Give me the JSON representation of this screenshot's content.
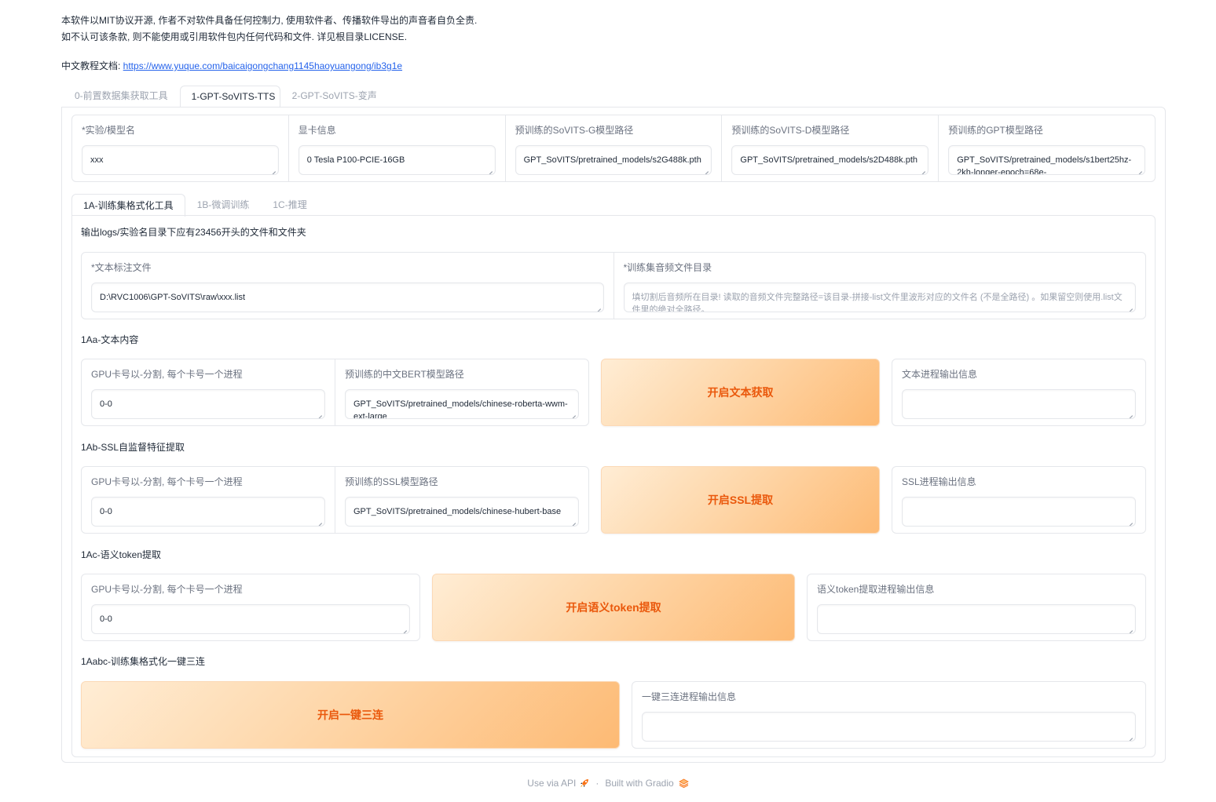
{
  "notice": {
    "line1": "本软件以MIT协议开源, 作者不对软件具备任何控制力, 使用软件者、传播软件导出的声音者自负全责.",
    "line2": "如不认可该条款, 则不能使用或引用软件包内任何代码和文件. 详见根目录LICENSE."
  },
  "doc": {
    "label": "中文教程文档: ",
    "link": "https://www.yuque.com/baicaigongchang1145haoyuangong/ib3g1e"
  },
  "top_tabs": [
    "0-前置数据集获取工具",
    "1-GPT-SoVITS-TTS",
    "2-GPT-SoVITS-变声"
  ],
  "model_row": [
    {
      "label": "*实验/模型名",
      "value": "xxx"
    },
    {
      "label": "显卡信息",
      "value": "0 Tesla P100-PCIE-16GB"
    },
    {
      "label": "预训练的SoVITS-G模型路径",
      "value": "GPT_SoVITS/pretrained_models/s2G488k.pth"
    },
    {
      "label": "预训练的SoVITS-D模型路径",
      "value": "GPT_SoVITS/pretrained_models/s2D488k.pth"
    },
    {
      "label": "预训练的GPT模型路径",
      "value": "GPT_SoVITS/pretrained_models/s1bert25hz-2kh-longer-epoch=68e-"
    }
  ],
  "sub_tabs": [
    "1A-训练集格式化工具",
    "1B-微调训练",
    "1C-推理"
  ],
  "info_text": "输出logs/实验名目录下应有23456开头的文件和文件夹",
  "text_label_file": {
    "label": "*文本标注文件",
    "value": "D:\\RVC1006\\GPT-SoVITS\\raw\\xxx.list"
  },
  "audio_dir": {
    "label": "*训练集音频文件目录",
    "placeholder": "填切割后音频所在目录! 读取的音频文件完整路径=该目录-拼接-list文件里波形对应的文件名 (不是全路径) 。如果留空则使用.list文件里的绝对全路径。"
  },
  "sec_1aa": {
    "title": "1Aa-文本内容",
    "gpu_label": "GPU卡号以-分割, 每个卡号一个进程",
    "gpu_value": "0-0",
    "bert_label": "预训练的中文BERT模型路径",
    "bert_value": "GPT_SoVITS/pretrained_models/chinese-roberta-wwm-ext-large",
    "button": "开启文本获取",
    "output_label": "文本进程输出信息"
  },
  "sec_1ab": {
    "title": "1Ab-SSL自监督特征提取",
    "gpu_label": "GPU卡号以-分割, 每个卡号一个进程",
    "gpu_value": "0-0",
    "ssl_label": "预训练的SSL模型路径",
    "ssl_value": "GPT_SoVITS/pretrained_models/chinese-hubert-base",
    "button": "开启SSL提取",
    "output_label": "SSL进程输出信息"
  },
  "sec_1ac": {
    "title": "1Ac-语义token提取",
    "gpu_label": "GPU卡号以-分割, 每个卡号一个进程",
    "gpu_value": "0-0",
    "button": "开启语义token提取",
    "output_label": "语义token提取进程输出信息"
  },
  "sec_1abc": {
    "title": "1Aabc-训练集格式化一键三连",
    "button": "开启一键三连",
    "output_label": "一键三连进程输出信息"
  },
  "footer": {
    "api": "Use via API",
    "separator": "·",
    "built": "Built with Gradio"
  },
  "colors": {
    "accent": "#ea580c",
    "button_gradient_start": "#ffedd5",
    "button_gradient_end": "#fdba74",
    "link": "#2563eb",
    "border": "#e5e7eb"
  }
}
